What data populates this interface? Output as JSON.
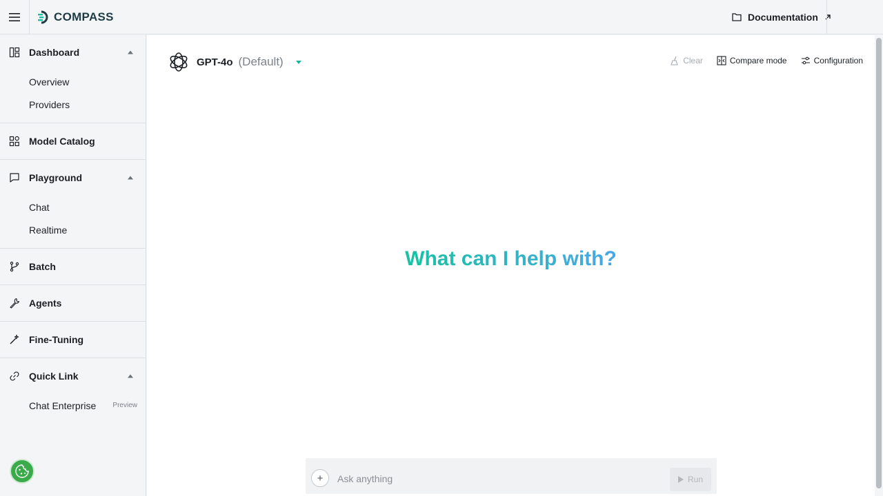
{
  "header": {
    "logo_text": "COMPASS",
    "documentation_label": "Documentation"
  },
  "sidebar": {
    "groups": [
      {
        "label": "Dashboard",
        "icon": "dashboard-icon",
        "expanded": true,
        "items": [
          {
            "label": "Overview"
          },
          {
            "label": "Providers"
          }
        ]
      },
      {
        "label": "Model Catalog",
        "icon": "model-catalog-icon",
        "items": []
      },
      {
        "label": "Playground",
        "icon": "chat-bubble-icon",
        "expanded": true,
        "items": [
          {
            "label": "Chat"
          },
          {
            "label": "Realtime"
          }
        ]
      },
      {
        "label": "Batch",
        "icon": "branch-icon",
        "items": []
      },
      {
        "label": "Agents",
        "icon": "wrench-icon",
        "items": []
      },
      {
        "label": "Fine-Tuning",
        "icon": "wand-icon",
        "items": []
      },
      {
        "label": "Quick Link",
        "icon": "link-icon",
        "expanded": true,
        "items": [
          {
            "label": "Chat Enterprise",
            "badge": "Preview"
          }
        ]
      }
    ]
  },
  "main": {
    "model": {
      "name": "GPT-4o",
      "tag": "(Default)",
      "icon": "openai-logo-icon"
    },
    "toolbar": {
      "clear_label": "Clear",
      "compare_label": "Compare mode",
      "configuration_label": "Configuration"
    },
    "welcome": "What can I help with?",
    "composer": {
      "placeholder": "Ask anything",
      "run_label": "Run"
    }
  },
  "colors": {
    "accent_teal": "#17c2a2",
    "accent_blue": "#4aa7e6",
    "cookie_green": "#3aaa4b"
  }
}
